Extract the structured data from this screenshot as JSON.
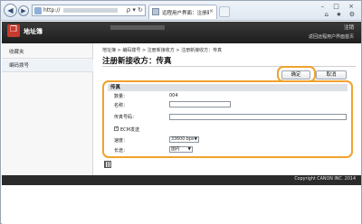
{
  "browser": {
    "address_prefix": "http://",
    "address_tools": "ρ ▾ ↻",
    "tab_label": "远程用户界面：注册新接收...",
    "tab_close": "×",
    "window_controls": "–  □  ×",
    "toolbar_icons": "⌂ ★ ⚙"
  },
  "app": {
    "logo_glyph": "❐",
    "title": "地址簿",
    "logout": "注销",
    "home_link": "返回远程用户界面首页"
  },
  "sidebar": {
    "items": [
      {
        "label": "收藏夹"
      },
      {
        "label": "编码拨号"
      }
    ]
  },
  "breadcrumb": "地址簿 > 编码拨号 > 注册新接收方 > 注册新接收方：传真",
  "page_title": "注册新接收方：传真",
  "buttons": {
    "ok": "确定",
    "cancel": "取消"
  },
  "panel": {
    "header": "传真",
    "fields": [
      {
        "label": "数量：",
        "value": "004"
      },
      {
        "label": "名称：",
        "value": ""
      },
      {
        "label": "传真号码：",
        "value": ""
      },
      {
        "label": "ECM发送",
        "checked": true
      },
      {
        "label": "速度：",
        "value": "33600 bps"
      },
      {
        "label": "长途：",
        "value": "国内"
      }
    ]
  },
  "footer": {
    "copyright": "Copyright CANON INC. 2014"
  }
}
